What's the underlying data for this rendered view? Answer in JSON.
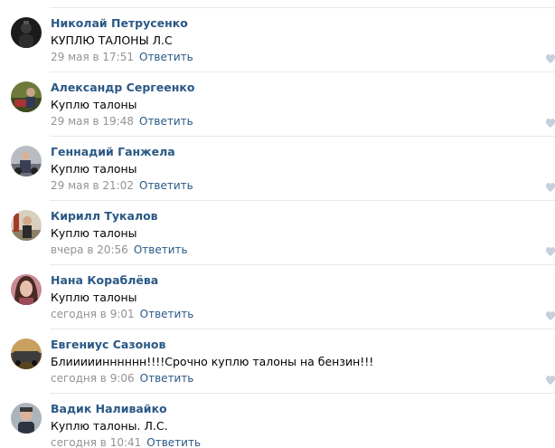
{
  "comments": [
    {
      "author": "Николай Петрусенко",
      "text": "КУПЛЮ ТАЛОНЫ Л.С",
      "date": "29 мая в 17:51",
      "reply": "Ответить",
      "avatar_color": "#1b1b1b"
    },
    {
      "author": "Александр Сергеенко",
      "text": "Куплю талоны",
      "date": "29 мая в 19:48",
      "reply": "Ответить",
      "avatar_color": "#6d7a3a"
    },
    {
      "author": "Геннадий Ганжела",
      "text": "Куплю талоны",
      "date": "29 мая в 21:02",
      "reply": "Ответить",
      "avatar_color": "#8d8f97"
    },
    {
      "author": "Кирилл Тукалов",
      "text": "Куплю талоны",
      "date": "вчера в 20:56",
      "reply": "Ответить",
      "avatar_color": "#a99a7a"
    },
    {
      "author": "Нана Кораблёва",
      "text": "Куплю талоны",
      "date": "сегодня в 9:01",
      "reply": "Ответить",
      "avatar_color": "#9c5b63"
    },
    {
      "author": "Евгениус Сазонов",
      "text": "Блииииинннннн!!!!Срочно куплю талоны на бензин!!!",
      "date": "сегодня в 9:06",
      "reply": "Ответить",
      "avatar_color": "#7a6238"
    },
    {
      "author": "Вадик Наливайко",
      "text": "Куплю талоны. Л.С.",
      "date": "сегодня в 10:41",
      "reply": "Ответить",
      "avatar_color": "#5f6a74"
    }
  ]
}
